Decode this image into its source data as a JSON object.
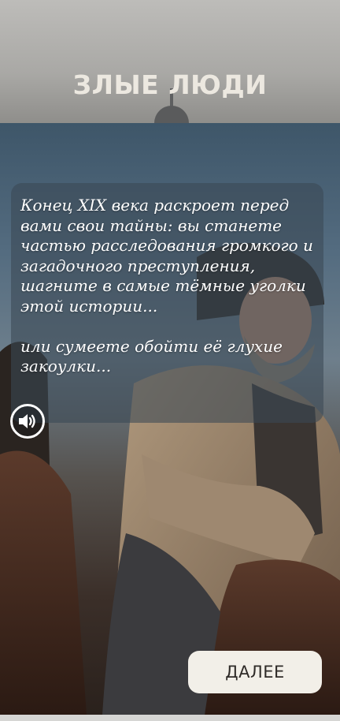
{
  "header": {
    "title": "ЗЛЫЕ ЛЮДИ"
  },
  "intro": {
    "text": "Конец XIX века раскроет перед вами свои тайны: вы станете частью расследования громкого и загадочного преступления, шагните в самые тёмные уголки этой истории...\n\nили сумеете обойти её глухие закоулки..."
  },
  "controls": {
    "sound_icon": "speaker-volume-icon",
    "next_label": "ДАЛЕЕ"
  },
  "colors": {
    "title": "#ece8e0",
    "panel": "#3a4854",
    "button_bg": "#f2efe8",
    "button_text": "#2f2b28"
  }
}
